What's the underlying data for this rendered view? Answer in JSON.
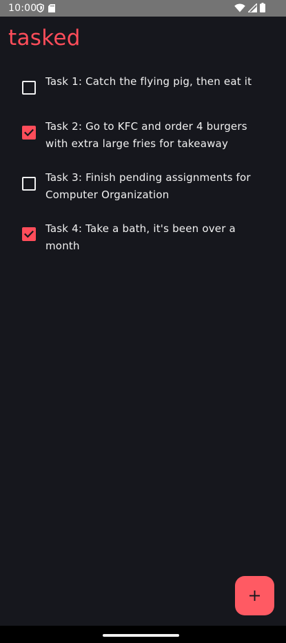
{
  "status_bar": {
    "time": "10:00",
    "left_icons": [
      "shield-icon",
      "sd-card-icon"
    ],
    "right_icons": [
      "wifi-icon",
      "signal-icon",
      "battery-icon"
    ]
  },
  "app": {
    "title": "tasked",
    "accent_color": "#ff4d5a",
    "background_color": "#16171d"
  },
  "tasks": [
    {
      "label": "Task 1: Catch the flying pig, then eat it",
      "checked": false
    },
    {
      "label": "Task 2: Go to KFC and order 4 burgers with extra large fries for takeaway",
      "checked": true
    },
    {
      "label": "Task 3: Finish pending assignments for Computer Organization",
      "checked": false
    },
    {
      "label": "Task 4: Take a bath, it's been over a month",
      "checked": true
    }
  ],
  "fab": {
    "icon": "plus-icon"
  }
}
